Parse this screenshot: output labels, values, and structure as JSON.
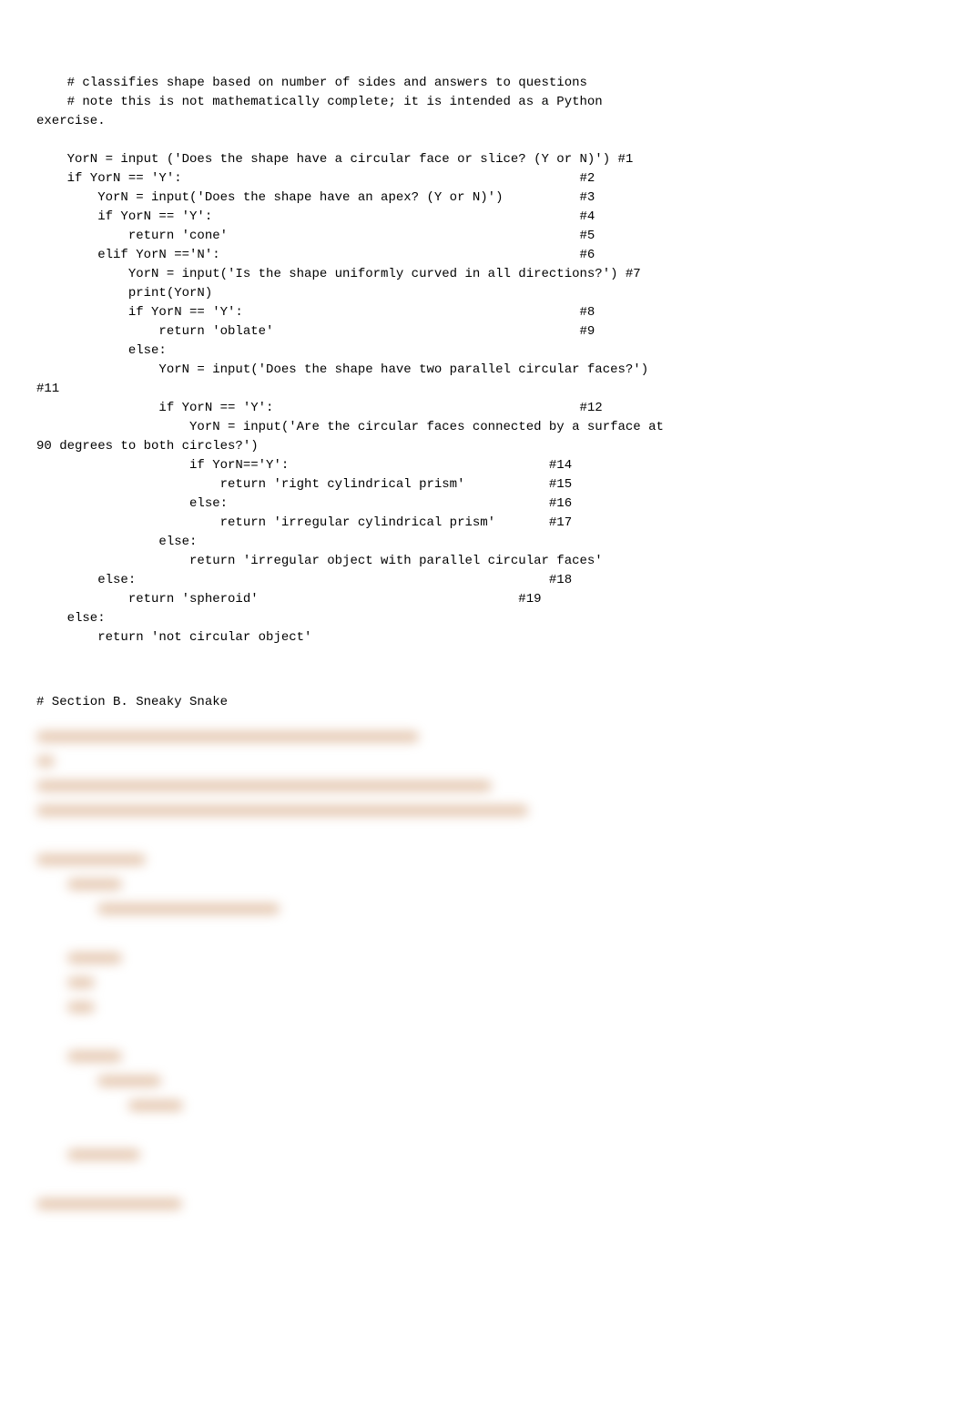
{
  "code": {
    "comment1": "    # classifies shape based on number of sides and answers to questions",
    "comment2": "    # note this is not mathematically complete; it is intended as a Python",
    "comment2b": "exercise.",
    "l1": "    YorN = input ('Does the shape have a circular face or slice? (Y or N)') #1",
    "l2": "    if YorN == 'Y':                                                    #2",
    "l3": "        YorN = input('Does the shape have an apex? (Y or N)')          #3",
    "l4": "        if YorN == 'Y':                                                #4",
    "l5": "            return 'cone'                                              #5",
    "l6": "        elif YorN =='N':                                               #6",
    "l7": "            YorN = input('Is the shape uniformly curved in all directions?') #7",
    "l7b": "            print(YorN)",
    "l8": "            if YorN == 'Y':                                            #8",
    "l9": "                return 'oblate'                                        #9",
    "l10": "            else:",
    "l11": "                YorN = input('Does the shape have two parallel circular faces?')",
    "l11b": "#11",
    "l12": "                if YorN == 'Y':                                        #12",
    "l13": "                    YorN = input('Are the circular faces connected by a surface at",
    "l13b": "90 degrees to both circles?')",
    "l14": "                    if YorN=='Y':                                  #14",
    "l15": "                        return 'right cylindrical prism'           #15",
    "l16": "                    else:                                          #16",
    "l17": "                        return 'irregular cylindrical prism'       #17",
    "l18": "                else:",
    "l19": "                    return 'irregular object with parallel circular faces'",
    "l20": "        else:                                                      #18",
    "l21": "            return 'spheroid'                                  #19",
    "l22": "    else:",
    "l23": "        return 'not circular object'"
  },
  "section_b": "# Section B. Sneaky Snake"
}
